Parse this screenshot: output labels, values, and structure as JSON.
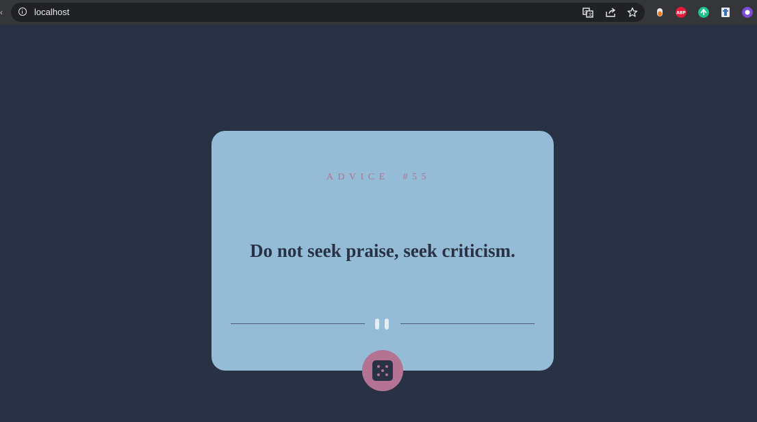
{
  "browser": {
    "url": "localhost",
    "actions": [
      "translate-icon",
      "share-icon",
      "bookmark-star-icon"
    ],
    "extensions": [
      {
        "name": "extension-orange-icon",
        "color": "#e8e8e8"
      },
      {
        "name": "adblock-plus-icon",
        "label": "ABP",
        "color": "#e51a3a"
      },
      {
        "name": "extension-green-sync-icon",
        "color": "#1ec28b"
      },
      {
        "name": "extension-document-icon",
        "color": "#e8eaed"
      },
      {
        "name": "extension-purple-icon",
        "color": "#7c4ddb"
      }
    ]
  },
  "card": {
    "advice_label": "ADVICE  #55",
    "quote": "Do not seek praise, seek criticism.",
    "divider_icon": "pause-icon",
    "action_icon": "dice-icon"
  },
  "colors": {
    "page_background": "#293245",
    "card_background": "#95bcd6",
    "accent": "#b47393",
    "quote_text": "#293245"
  }
}
